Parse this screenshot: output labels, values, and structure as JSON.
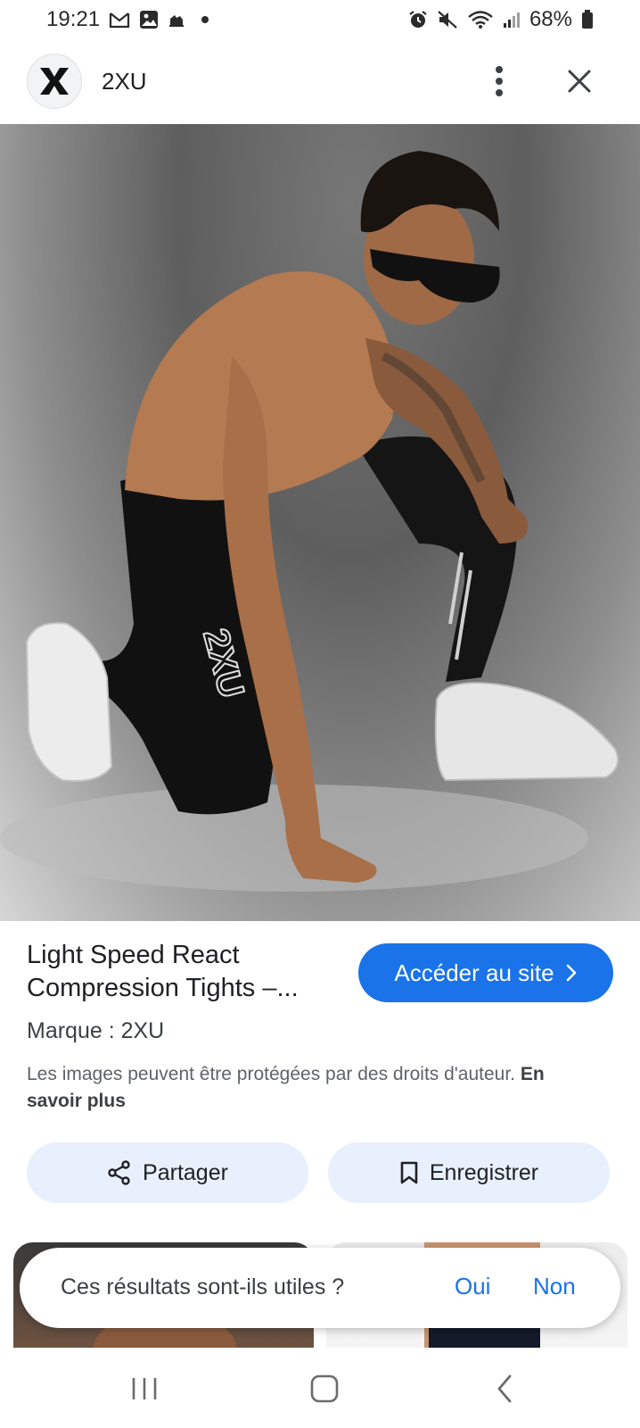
{
  "status_bar": {
    "time": "19:21",
    "battery": "68%",
    "icons_left": [
      "gmail-icon",
      "gallery-icon",
      "app-icon"
    ],
    "icons_right": [
      "alarm-icon",
      "mute-icon",
      "wifi-icon",
      "signal-icon",
      "battery-icon"
    ]
  },
  "header": {
    "title": "2XU",
    "logo_letter": "X"
  },
  "product": {
    "title": "Light Speed React Compression Tights –...",
    "visit_button": "Accéder au site",
    "brand": "Marque : 2XU",
    "copyright_text": "Les images peuvent être protégées par des droits d'auteur.",
    "learn_more": "En savoir plus"
  },
  "actions": {
    "share_label": "Partager",
    "save_label": "Enregistrer"
  },
  "feedback": {
    "question": "Ces résultats sont-ils utiles ?",
    "yes": "Oui",
    "no": "Non"
  },
  "hero": {
    "legging_logo": "2XU"
  },
  "colors": {
    "accent": "#1a73e8",
    "chip_bg": "#e8f0fe"
  }
}
